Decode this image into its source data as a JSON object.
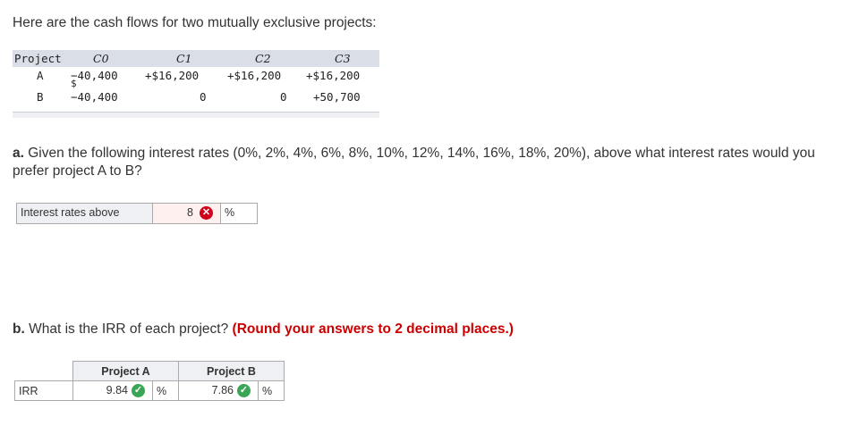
{
  "intro": "Here are the cash flows for two mutually exclusive projects:",
  "cashflow_table": {
    "headers": [
      "Project",
      "C0",
      "C1",
      "C2",
      "C3"
    ],
    "rows": [
      {
        "project": "A",
        "c0": "−40,400",
        "c0_symbol": "$",
        "c1": "+$16,200",
        "c2": "+$16,200",
        "c3": "+$16,200"
      },
      {
        "project": "B",
        "c0": "−40,400",
        "c1": "0",
        "c2": "0",
        "c3": "+50,700"
      }
    ]
  },
  "question_a": {
    "label": "a.",
    "text": "Given the following interest rates (0%, 2%, 4%, 6%, 8%, 10%, 12%, 14%, 16%, 18%, 20%), above what interest rates would you prefer project A to B?"
  },
  "answer_a": {
    "label": "Interest rates above",
    "value": "8",
    "status": "incorrect",
    "unit": "%"
  },
  "question_b": {
    "label": "b.",
    "text": "What is the IRR of each project?",
    "instruction": "(Round your answers to 2 decimal places.)"
  },
  "answer_b": {
    "headers": [
      "Project A",
      "Project B"
    ],
    "row_label": "IRR",
    "values": [
      {
        "value": "9.84",
        "status": "correct",
        "unit": "%"
      },
      {
        "value": "7.86",
        "status": "correct",
        "unit": "%"
      }
    ]
  },
  "colors": {
    "incorrect": "#d0021b",
    "correct": "#3aa655",
    "instruction": "#cc0000"
  }
}
